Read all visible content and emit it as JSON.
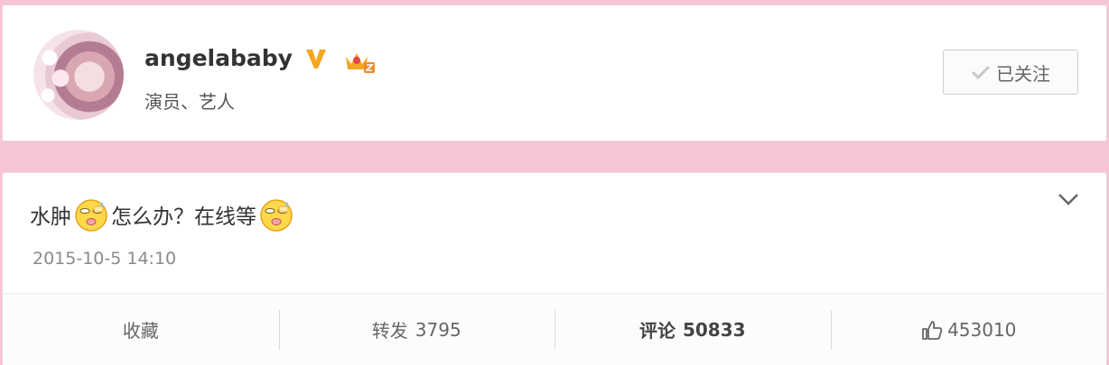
{
  "profile": {
    "username": "angelababy",
    "subtitle": "演员、艺人",
    "verified_icon": "verified-v-icon",
    "member_icon": "member-crown-icon",
    "follow_label": "已关注",
    "accent_color": "#f5a623"
  },
  "post": {
    "text_part1": "水肿",
    "text_part2": "怎么办？在线等",
    "emoji_icon": "sweat-face-emoji-icon",
    "timestamp": "2015-10-5 14:10",
    "actions": {
      "favorite_label": "收藏",
      "repost_label": "转发",
      "repost_count": "3795",
      "comment_label": "评论",
      "comment_count": "50833",
      "like_count": "453010"
    }
  },
  "colors": {
    "page_background": "#f7c5d3",
    "card_background": "#ffffff"
  }
}
